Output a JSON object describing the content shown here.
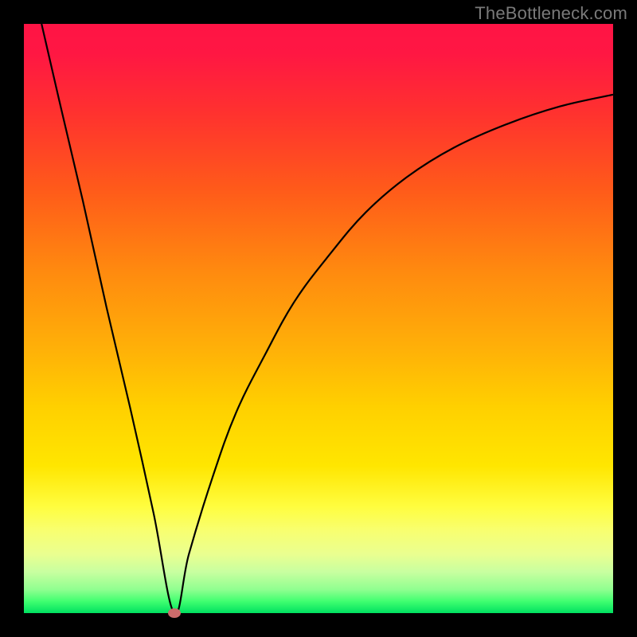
{
  "watermark": "TheBottleneck.com",
  "chart_data": {
    "type": "line",
    "title": "",
    "xlabel": "",
    "ylabel": "",
    "xlim": [
      0,
      100
    ],
    "ylim": [
      0,
      100
    ],
    "grid": false,
    "legend": false,
    "annotations": [],
    "series": [
      {
        "name": "left-branch",
        "x": [
          3,
          6,
          10,
          14,
          18,
          22,
          25.5
        ],
        "values": [
          100,
          87,
          70,
          52,
          35,
          17,
          0
        ]
      },
      {
        "name": "right-branch",
        "x": [
          25.5,
          28,
          32,
          36,
          41,
          46,
          52,
          58,
          65,
          73,
          82,
          91,
          100
        ],
        "values": [
          0,
          10,
          23,
          34,
          44,
          53,
          61,
          68,
          74,
          79,
          83,
          86,
          88
        ]
      }
    ],
    "marker": {
      "x": 25.5,
      "y": 0
    },
    "colors": {
      "curve": "#000000",
      "marker": "#cb6b6b",
      "frame": "#000000",
      "gradient_top": "#ff1445",
      "gradient_bottom": "#00e060"
    }
  }
}
